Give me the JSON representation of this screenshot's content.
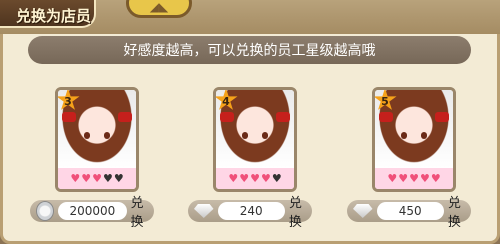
{
  "header": {
    "title": "兑换为店员"
  },
  "banner": {
    "text": "好感度越高，可以兑换的员工星级越高哦"
  },
  "cards": [
    {
      "star": "3",
      "hearts_filled": 3,
      "hearts_total": 5,
      "currency_icon": "coin-icon",
      "price": "200000",
      "exchange_label": "兑换"
    },
    {
      "star": "4",
      "hearts_filled": 4,
      "hearts_total": 5,
      "currency_icon": "diamond-icon",
      "price": "240",
      "exchange_label": "兑换"
    },
    {
      "star": "5",
      "hearts_filled": 5,
      "hearts_total": 5,
      "currency_icon": "diamond-icon",
      "price": "450",
      "exchange_label": "兑换"
    }
  ],
  "colors": {
    "panel_bg": "#f3ebd5",
    "title_tab": "#4f351f",
    "banner_bg": "#8c7d6d",
    "heart_on": "#f0507a",
    "heart_off": "#333333",
    "star": "#f6a21a"
  }
}
